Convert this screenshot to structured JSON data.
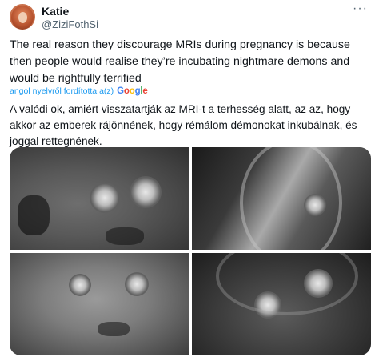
{
  "author": {
    "name": "Katie",
    "handle": "@ZiziFothSi"
  },
  "tweet": {
    "text": "The real reason they discourage MRIs during pregnancy is because then people would realise they’re incubating nightmare demons and would be rightfully terrified",
    "translated_note": "angol nyelvről fordította a(z)",
    "translator_brand": "Google",
    "translation": "A valódi ok, amiért visszatartják az MRI-t a terhesség alatt, az az, hogy akkor az emberek rájönnének, hogy rémálom démonokat inkubálnak, és joggal rettegnének."
  },
  "icons": {
    "more": "more-options-icon",
    "avatar": "avatar"
  },
  "colors": {
    "link": "#1d9bf0",
    "secondary_text": "#536471",
    "primary_text": "#0f1419",
    "google_blue": "#4285f4",
    "google_red": "#ea4335",
    "google_yellow": "#fbbc05",
    "google_green": "#34a853"
  }
}
